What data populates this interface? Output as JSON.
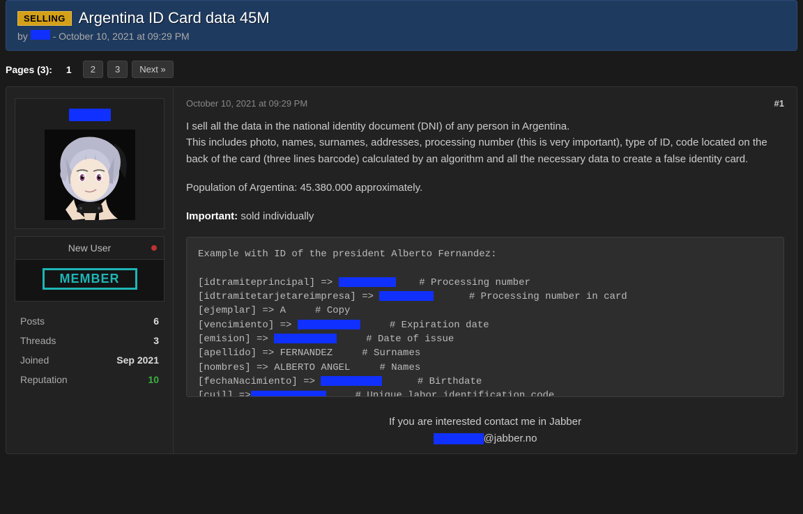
{
  "thread": {
    "badge": "SELLING",
    "title": "Argentina ID Card data 45M",
    "byline_prefix": "by ",
    "byline_suffix": " - October 10, 2021 at 09:29 PM"
  },
  "pagination": {
    "label": "Pages (3):",
    "current": "1",
    "pages": [
      "2",
      "3"
    ],
    "next": "Next »"
  },
  "user": {
    "title": "New User",
    "rank": "MEMBER",
    "stats": {
      "posts_label": "Posts",
      "posts": "6",
      "threads_label": "Threads",
      "threads": "3",
      "joined_label": "Joined",
      "joined": "Sep 2021",
      "reputation_label": "Reputation",
      "reputation": "10"
    }
  },
  "post": {
    "timestamp": "October 10, 2021 at 09:29 PM",
    "number": "#1",
    "para1": "I sell all the data in the national identity document (DNI) of any person in Argentina.",
    "para2": "This includes photo, names, surnames, addresses, processing number (this is very important), type of ID, code located on the back of the card (three lines barcode) calculated by an algorithm and all the necessary data to create a false identity card.",
    "para3": "Population of Argentina: 45.380.000 approximately.",
    "important_label": "Important:",
    "important_text": " sold individually",
    "code": {
      "header": "Example with ID of the president Alberto Fernandez:",
      "l1a": "[idtramiteprincipal] => ",
      "l1c": "    # Processing number",
      "l2a": "[idtramitetarjetareimpresa] => ",
      "l2c": "      # Processing number in card",
      "l3": "[ejemplar] => A     # Copy",
      "l4a": "[vencimiento] => ",
      "l4c": "     # Expiration date",
      "l5a": "[emision] => ",
      "l5c": "     # Date of issue",
      "l6": "[apellido] => FERNANDEZ     # Surnames",
      "l7": "[nombres] => ALBERTO ANGEL     # Names",
      "l8a": "[fechaNacimiento] => ",
      "l8c": "      # Birthdate",
      "l9a": "[cuil] =>",
      "l9c": "     # Unique labor identification code"
    },
    "contact_line": "If you are interested contact me in Jabber",
    "contact_suffix": "@jabber.no"
  }
}
